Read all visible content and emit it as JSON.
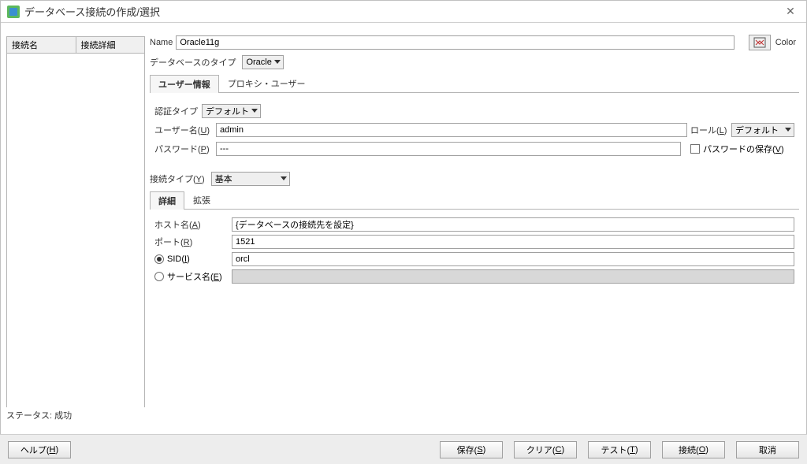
{
  "window": {
    "title": "データベース接続の作成/選択"
  },
  "left": {
    "cols": [
      "接続名",
      "接続詳細"
    ],
    "status": "ステータス: 成功"
  },
  "form": {
    "name_label": "Name",
    "name_value": "Oracle11g",
    "dbtype_label": "データベースのタイプ",
    "dbtype_value": "Oracle",
    "color_label": "Color"
  },
  "tabs": {
    "userinfo": "ユーザー情報",
    "proxy": "プロキシ・ユーザー"
  },
  "userinfo": {
    "auth_label": "認証タイプ",
    "auth_value": "デフォルト",
    "user_label_prefix": "ユーザー名(",
    "user_label_key": "U",
    "user_label_suffix": ")",
    "user_value": "admin",
    "pass_label_prefix": "パスワード(",
    "pass_label_key": "P",
    "pass_label_suffix": ")",
    "pass_value": "---",
    "role_label_prefix": "ロール(",
    "role_label_key": "L",
    "role_label_suffix": ")",
    "role_value": "デフォルト",
    "savepw_prefix": "パスワードの保存(",
    "savepw_key": "V",
    "savepw_suffix": ")"
  },
  "conn": {
    "type_label_prefix": "接続タイプ(",
    "type_label_key": "Y",
    "type_label_suffix": ")",
    "type_value": "基本",
    "subtabs": {
      "detail": "詳細",
      "ext": "拡張"
    },
    "host_label_prefix": "ホスト名(",
    "host_label_key": "A",
    "host_label_suffix": ")",
    "host_value": "{データベースの接続先を設定}",
    "port_label_prefix": "ポート(",
    "port_label_key": "R",
    "port_label_suffix": ")",
    "port_value": "1521",
    "sid_label_prefix": "SID(",
    "sid_label_key": "I",
    "sid_label_suffix": ")",
    "sid_value": "orcl",
    "svc_label_prefix": "サービス名(",
    "svc_label_key": "E",
    "svc_label_suffix": ")"
  },
  "buttons": {
    "help_prefix": "ヘルプ(",
    "help_key": "H",
    "help_suffix": ")",
    "save_prefix": "保存(",
    "save_key": "S",
    "save_suffix": ")",
    "clear_prefix": "クリア(",
    "clear_key": "C",
    "clear_suffix": ")",
    "test_prefix": "テスト(",
    "test_key": "T",
    "test_suffix": ")",
    "connect_prefix": "接続(",
    "connect_key": "O",
    "connect_suffix": ")",
    "cancel": "取消"
  }
}
